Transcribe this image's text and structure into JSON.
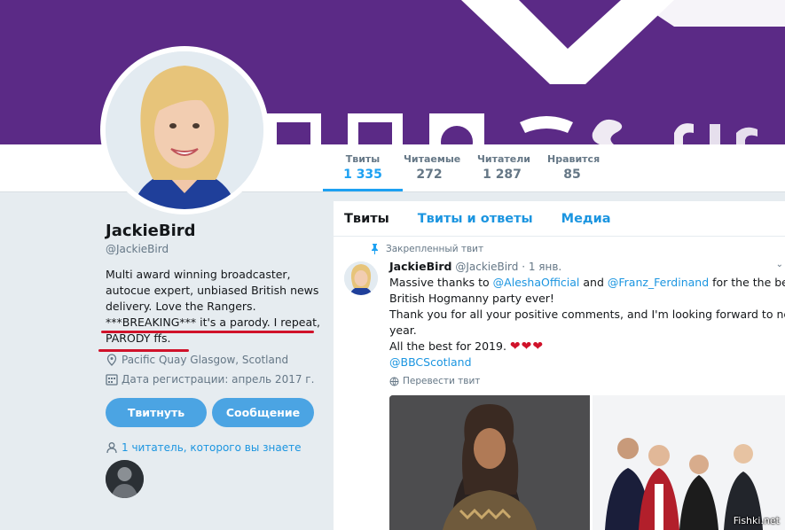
{
  "nav": {
    "stats": [
      {
        "label": "Твиты",
        "value": "1 335"
      },
      {
        "label": "Читаемые",
        "value": "272"
      },
      {
        "label": "Читатели",
        "value": "1 287"
      },
      {
        "label": "Нравится",
        "value": "85"
      }
    ]
  },
  "profile": {
    "name": "JackieBird",
    "handle": "@JackieBird",
    "bio_lines": [
      "Multi award winning broadcaster,",
      "autocue expert, unbiased British news",
      "delivery. Love the Rangers.",
      "***BREAKING*** it's a parody. I repeat,",
      "PARODY ffs."
    ],
    "location": "Pacific Quay Glasgow, Scotland",
    "joined": "Дата регистрации: апрель 2017 г.",
    "tweet_button": "Твитнуть",
    "message_button": "Сообщение",
    "followers_you_know": "1 читатель, которого вы знаете"
  },
  "timeline": {
    "tabs": [
      "Твиты",
      "Твиты и ответы",
      "Медиа"
    ],
    "pinned_label": "Закрепленный твит",
    "tweet": {
      "name": "JackieBird",
      "handle": "@JackieBird",
      "date": "· 1 янв.",
      "line1_pre": "Massive thanks to ",
      "mention1": "@AleshaOfficial",
      "line1_mid": " and ",
      "mention2": "@Franz_Ferdinand",
      "line1_post": " for the the best",
      "line2": "British Hogmanny party ever!",
      "line3": "Thank you for all your positive comments, and I'm looking forward to next",
      "line4": "year.",
      "line5": "All the best for 2019.",
      "hearts": "❤❤❤",
      "mention3": "@BBCScotland",
      "translate": "Перевести твит"
    }
  },
  "watermark": "Fishki.net",
  "colors": {
    "banner": "#5b2a86",
    "accent": "#1da1f2",
    "annotation": "#d0122a"
  }
}
